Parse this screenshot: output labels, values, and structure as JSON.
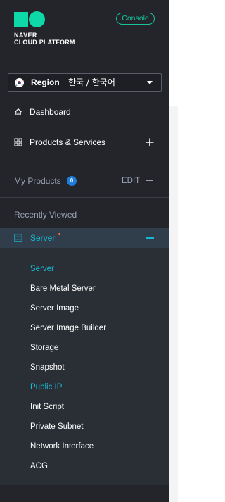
{
  "brand": {
    "line1": "NAVER",
    "line2": "CLOUD PLATFORM",
    "accent_color": "#0fd8a8"
  },
  "console_button": {
    "label": "Console"
  },
  "region": {
    "label_bold": "Region",
    "label_lang": "한국 / 한국어",
    "flag_icon": "korea-flag-icon",
    "caret_icon": "caret-down-icon"
  },
  "nav": {
    "dashboard": {
      "label": "Dashboard",
      "icon": "home-icon"
    },
    "products": {
      "label": "Products & Services",
      "icon": "grid-icon",
      "action_icon": "plus-icon"
    }
  },
  "my_products": {
    "label": "My Products",
    "count": "0",
    "edit_label": "EDIT",
    "collapse_icon": "minus-icon"
  },
  "recently_viewed": {
    "label": "Recently Viewed"
  },
  "server_group": {
    "label": "Server",
    "icon": "server-icon",
    "new_indicator_color": "#ff6a3d",
    "collapse_icon": "minus-icon",
    "items": [
      {
        "label": "Server",
        "active": true
      },
      {
        "label": "Bare Metal Server",
        "active": false
      },
      {
        "label": "Server Image",
        "active": false
      },
      {
        "label": "Server Image Builder",
        "active": false
      },
      {
        "label": "Storage",
        "active": false
      },
      {
        "label": "Snapshot",
        "active": false
      },
      {
        "label": "Public IP",
        "active": true
      },
      {
        "label": "Init Script",
        "active": false
      },
      {
        "label": "Private Subnet",
        "active": false
      },
      {
        "label": "Network Interface",
        "active": false
      },
      {
        "label": "ACG",
        "active": false
      }
    ]
  },
  "colors": {
    "sidebar_bg": "#23252b",
    "highlight_text": "#18b9d4",
    "muted_text": "#9aa3b5",
    "badge_bg": "#1e7ddc"
  }
}
